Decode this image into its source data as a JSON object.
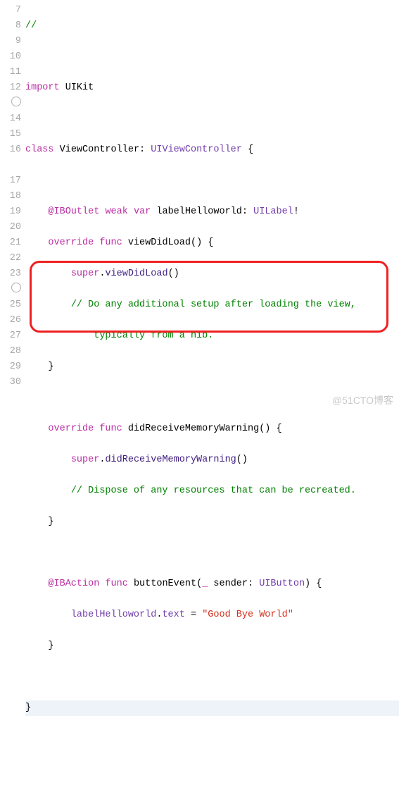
{
  "gutter": {
    "nums": [
      "7",
      "8",
      "9",
      "10",
      "11",
      "12",
      "",
      "14",
      "15",
      "16",
      "",
      "17",
      "18",
      "19",
      "20",
      "21",
      "22",
      "23",
      "",
      "25",
      "26",
      "27",
      "28",
      "29",
      "30"
    ],
    "breakpoint_rows": [
      6,
      18
    ]
  },
  "code": {
    "l7": {
      "sl": "//"
    },
    "l9": {
      "imp": "import",
      "mod": "UIKit"
    },
    "l11": {
      "kw1": "class",
      "name": "ViewController",
      "colon": ":",
      "base": "UIViewController",
      "brace": "{"
    },
    "l13": {
      "attr": "@IBOutlet",
      "weak": "weak",
      "var": "var",
      "name": "labelHelloworld",
      "colon": ":",
      "type": "UILabel",
      "bang": "!"
    },
    "l14": {
      "ov": "override",
      "fn": "func",
      "name": "viewDidLoad",
      "par": "()",
      "brace": "{"
    },
    "l15": {
      "sup": "super",
      "dot": ".",
      "call": "viewDidLoad",
      "par": "()"
    },
    "l16a": {
      "c": "// Do any additional setup after loading the view,"
    },
    "l16b": {
      "c": "typically from a nib."
    },
    "l17": {
      "brace": "}"
    },
    "l19": {
      "ov": "override",
      "fn": "func",
      "name": "didReceiveMemoryWarning",
      "par": "()",
      "brace": "{"
    },
    "l20": {
      "sup": "super",
      "dot": ".",
      "call": "didReceiveMemoryWarning",
      "par": "()"
    },
    "l21": {
      "c": "// Dispose of any resources that can be recreated."
    },
    "l22": {
      "brace": "}"
    },
    "l24": {
      "attr": "@IBAction",
      "fn": "func",
      "name": "buttonEvent",
      "lp": "(",
      "und": "_",
      "arg": "sender",
      "colon": ":",
      "type": "UIButton",
      "rp": ")",
      "brace": "{"
    },
    "l25": {
      "obj": "labelHelloworld",
      "dot": ".",
      "prop": "text",
      "eq": "=",
      "str": "\"Good Bye World\""
    },
    "l26": {
      "brace": "}"
    },
    "l28": {
      "brace": "}"
    }
  },
  "watermark": "@51CTO博客"
}
